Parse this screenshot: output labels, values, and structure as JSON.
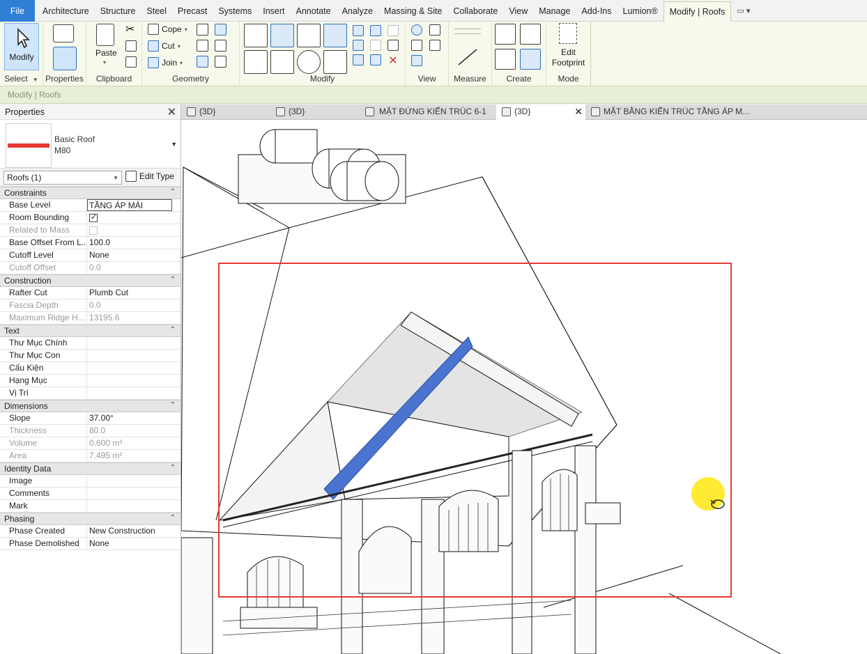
{
  "menu": {
    "file": "File",
    "tabs": [
      "Architecture",
      "Structure",
      "Steel",
      "Precast",
      "Systems",
      "Insert",
      "Annotate",
      "Analyze",
      "Massing & Site",
      "Collaborate",
      "View",
      "Manage",
      "Add-Ins",
      "Lumion®"
    ],
    "active_tab": "Modify | Roofs"
  },
  "ribbon": {
    "select": {
      "modify": "Modify",
      "title": "Select"
    },
    "properties": {
      "title": "Properties"
    },
    "clipboard": {
      "paste": "Paste",
      "title": "Clipboard"
    },
    "geometry": {
      "cope": "Cope",
      "cut": "Cut",
      "join": "Join",
      "title": "Geometry"
    },
    "modify": {
      "title": "Modify"
    },
    "view": {
      "title": "View"
    },
    "measure": {
      "title": "Measure"
    },
    "create": {
      "title": "Create"
    },
    "mode": {
      "edit_footprint": "Edit Footprint",
      "title": "Mode"
    }
  },
  "context_bar": "Modify | Roofs",
  "properties": {
    "header": "Properties",
    "type_family": "Basic Roof",
    "type_name": "M80",
    "instance_filter": "Roofs (1)",
    "edit_type": "Edit Type",
    "groups": [
      {
        "name": "Constraints",
        "rows": [
          {
            "n": "Base Level",
            "v": "TẦNG ÁP MÁI",
            "state": "edit"
          },
          {
            "n": "Room Bounding",
            "v": "",
            "check": true
          },
          {
            "n": "Related to Mass",
            "v": "",
            "check": false,
            "disabled": true
          },
          {
            "n": "Base Offset From L...",
            "v": "100.0"
          },
          {
            "n": "Cutoff Level",
            "v": "None"
          },
          {
            "n": "Cutoff Offset",
            "v": "0.0",
            "disabled": true
          }
        ]
      },
      {
        "name": "Construction",
        "rows": [
          {
            "n": "Rafter Cut",
            "v": "Plumb Cut"
          },
          {
            "n": "Fascia Depth",
            "v": "0.0",
            "disabled": true
          },
          {
            "n": "Maximum Ridge H...",
            "v": "13195.6",
            "disabled": true
          }
        ]
      },
      {
        "name": "Text",
        "rows": [
          {
            "n": "Thư Mục Chính",
            "v": ""
          },
          {
            "n": "Thư Mục Con",
            "v": ""
          },
          {
            "n": "Cấu Kiện",
            "v": ""
          },
          {
            "n": "Hạng Mục",
            "v": ""
          },
          {
            "n": "Vị Trí",
            "v": ""
          }
        ]
      },
      {
        "name": "Dimensions",
        "rows": [
          {
            "n": "Slope",
            "v": "37.00°"
          },
          {
            "n": "Thickness",
            "v": "80.0",
            "disabled": true
          },
          {
            "n": "Volume",
            "v": "0.600 m³",
            "disabled": true
          },
          {
            "n": "Area",
            "v": "7.495 m²",
            "disabled": true
          }
        ]
      },
      {
        "name": "Identity Data",
        "rows": [
          {
            "n": "Image",
            "v": ""
          },
          {
            "n": "Comments",
            "v": ""
          },
          {
            "n": "Mark",
            "v": ""
          }
        ]
      },
      {
        "name": "Phasing",
        "rows": [
          {
            "n": "Phase Created",
            "v": "New Construction"
          },
          {
            "n": "Phase Demolished",
            "v": "None"
          }
        ]
      }
    ]
  },
  "view_tabs": [
    {
      "label": "{3D}",
      "active": false
    },
    {
      "label": "{3D}",
      "active": false
    },
    {
      "label": "MẶT ĐỨNG KIẾN TRÚC 6-1",
      "active": false
    },
    {
      "label": "{3D}",
      "active": true
    },
    {
      "label": "MẶT BẰNG KIẾN TRÚC TẦNG ÁP M...",
      "active": false
    }
  ],
  "colors": {
    "ribbon_bg": "#f7f9ec",
    "file_tab": "#2f7fd6",
    "selected_roof_highlight": "#4a74d0",
    "selection_box": "#e53935",
    "cursor_highlight": "#ffe600"
  }
}
